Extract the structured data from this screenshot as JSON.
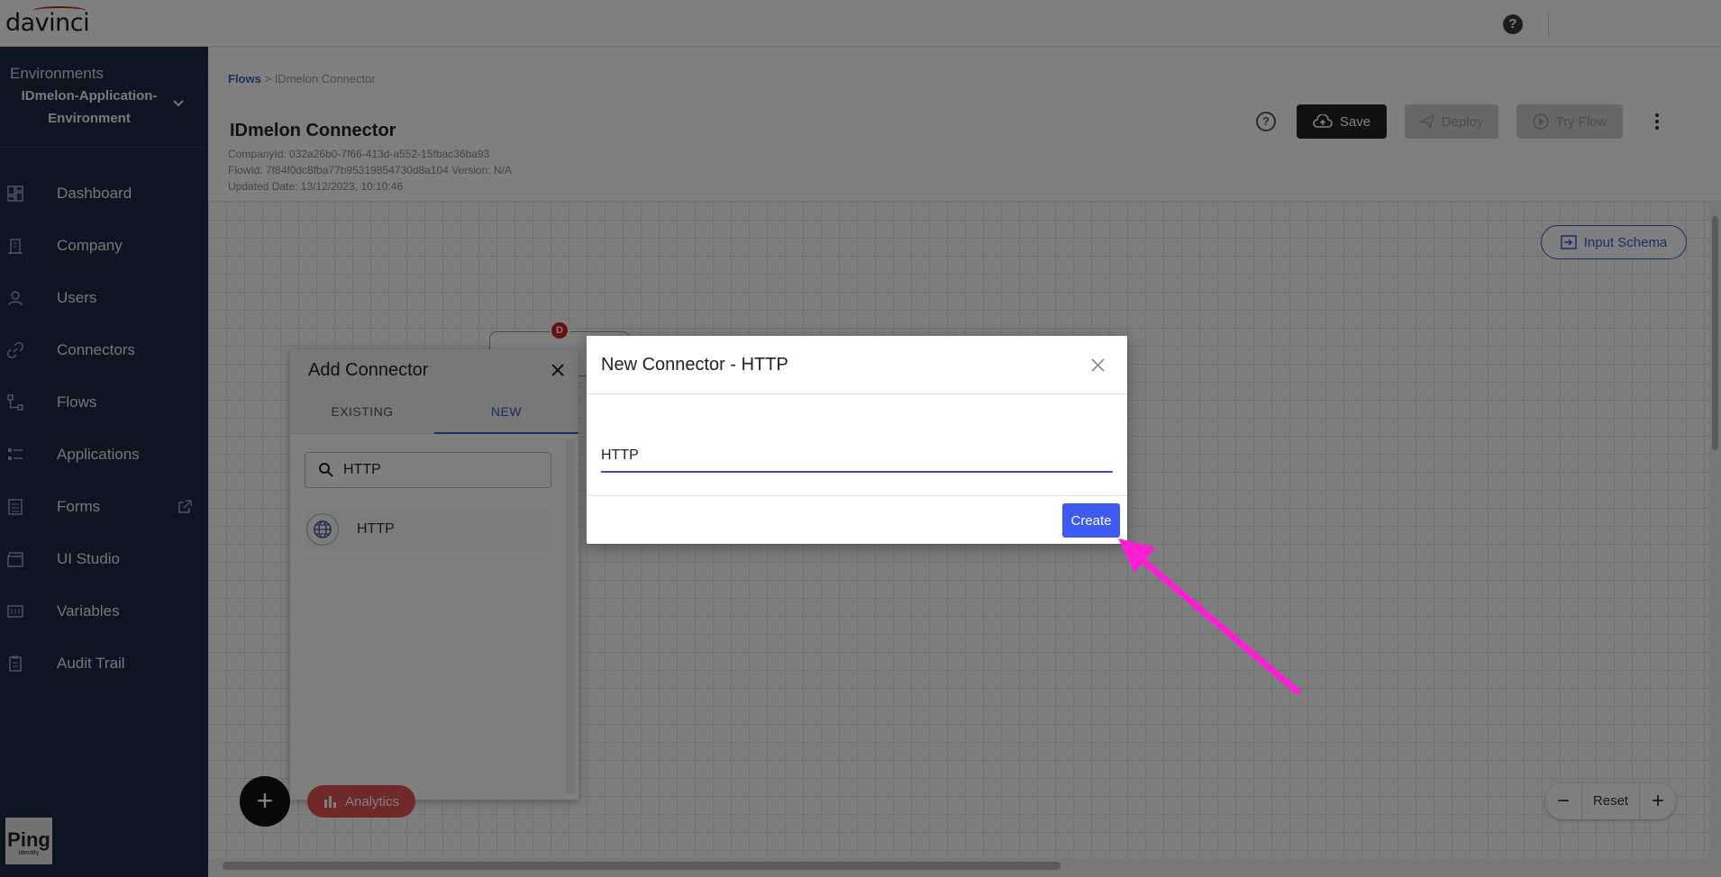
{
  "app": {
    "logo_text": "davinci",
    "help_symbol": "?"
  },
  "sidebar": {
    "environment_label": "Environments",
    "environment_name": "IDmelon-Application-Environment",
    "items": [
      {
        "label": "Dashboard",
        "icon": "dashboard-icon"
      },
      {
        "label": "Company",
        "icon": "building-icon"
      },
      {
        "label": "Users",
        "icon": "user-icon"
      },
      {
        "label": "Connectors",
        "icon": "link-icon"
      },
      {
        "label": "Flows",
        "icon": "flow-icon"
      },
      {
        "label": "Applications",
        "icon": "applications-icon"
      },
      {
        "label": "Forms",
        "icon": "form-icon"
      },
      {
        "label": "UI Studio",
        "icon": "clapper-icon"
      },
      {
        "label": "Variables",
        "icon": "sliders-icon"
      },
      {
        "label": "Audit Trail",
        "icon": "clipboard-icon"
      }
    ],
    "brand_logo": "Ping",
    "brand_sub": "Identity"
  },
  "header": {
    "breadcrumb_link": "Flows",
    "breadcrumb_sep": ">",
    "breadcrumb_current": "IDmelon Connector",
    "title": "IDmelon Connector",
    "company_id": "CompanyId: 032a26b0-7f66-413d-a552-15fbac36ba93",
    "flow_id": "FlowId: 7f84f0dc8fba77b95319854730d8a104 Version: N/A",
    "updated": "Updated Date: 13/12/2023, 10:10:46",
    "save_label": "Save",
    "deploy_label": "Deploy",
    "try_label": "Try Flow"
  },
  "canvas": {
    "input_schema_label": "Input Schema",
    "analytics_label": "Analytics",
    "reset_label": "Reset",
    "zoom_out": "−",
    "zoom_in": "+",
    "fab_symbol": "+",
    "node_badge": "D"
  },
  "add_connector": {
    "title": "Add Connector",
    "tab_existing": "EXISTING",
    "tab_new": "NEW",
    "search_value": "HTTP",
    "result_label": "HTTP"
  },
  "modal": {
    "title": "New Connector - HTTP",
    "input_value": "HTTP",
    "create_label": "Create"
  },
  "colors": {
    "sidebar_bg": "#1b2a47",
    "accent": "#3a5cc7",
    "create_button": "#3d5bf0",
    "annotation_arrow": "#ff1fd2"
  }
}
